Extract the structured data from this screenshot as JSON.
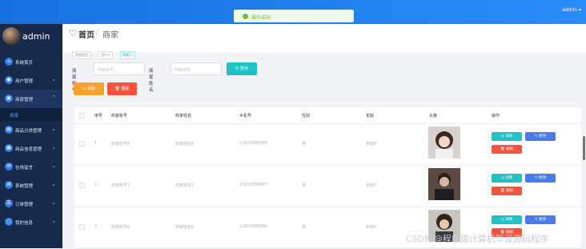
{
  "topbar": {
    "user": "admin ▾"
  },
  "toast": {
    "message": "操作成功"
  },
  "sidebar": {
    "user_name": "admin",
    "items": [
      {
        "label": "系统首页",
        "icon": "home-icon",
        "expanded": false,
        "chevron": ""
      },
      {
        "label": "用户管理",
        "icon": "user-icon",
        "expanded": false,
        "chevron": "⌄"
      },
      {
        "label": "商家管理",
        "icon": "store-icon",
        "expanded": true,
        "chevron": "⌃"
      },
      {
        "label": "商品分类管理",
        "icon": "category-icon",
        "expanded": false,
        "chevron": "⌄"
      },
      {
        "label": "商品信息管理",
        "icon": "goods-icon",
        "expanded": false,
        "chevron": "⌄"
      },
      {
        "label": "在线留言",
        "icon": "message-icon",
        "expanded": false,
        "chevron": "⌄"
      },
      {
        "label": "系统管理",
        "icon": "grid-icon",
        "expanded": false,
        "chevron": "⌄"
      },
      {
        "label": "订单管理",
        "icon": "order-icon",
        "expanded": false,
        "chevron": "⌄"
      },
      {
        "label": "我的信息",
        "icon": "profile-icon",
        "expanded": false,
        "chevron": "⌄"
      }
    ],
    "submenu": {
      "label": "商家"
    }
  },
  "header": {
    "home": "首页",
    "sep": "/",
    "current": "商家",
    "tags": [
      "系统首页",
      "用户×",
      "商家×"
    ]
  },
  "search": {
    "label1": "商家账号",
    "placeholder1": "商家账号",
    "label2": "商家姓名",
    "placeholder2": "商家姓名",
    "button": "Q 查询"
  },
  "toolbar": {
    "add": "+ 添加",
    "delete": "🗑 删除"
  },
  "table": {
    "headers": [
      "序号",
      "商家账号",
      "商家姓名",
      "手机号",
      "性别",
      "年龄",
      "头像",
      "操作"
    ],
    "rows": [
      {
        "no": "1",
        "account": "商家账号8",
        "name": "商家姓名8",
        "phone": "13823888888",
        "gender": "男",
        "age": "年龄8"
      },
      {
        "no": "2",
        "account": "商家账号7",
        "name": "商家姓名7",
        "phone": "13823888887",
        "gender": "男",
        "age": "年龄7"
      },
      {
        "no": "3",
        "account": "商家账号6",
        "name": "商家姓名6",
        "phone": "13823888886",
        "gender": "男",
        "age": "年龄6"
      }
    ],
    "actions": {
      "view": "◎ 详情",
      "edit": "✎ 修改",
      "delete": "🗑 删除"
    }
  },
  "watermark": "CSDN @程序猿计算机毕设源码程序"
}
